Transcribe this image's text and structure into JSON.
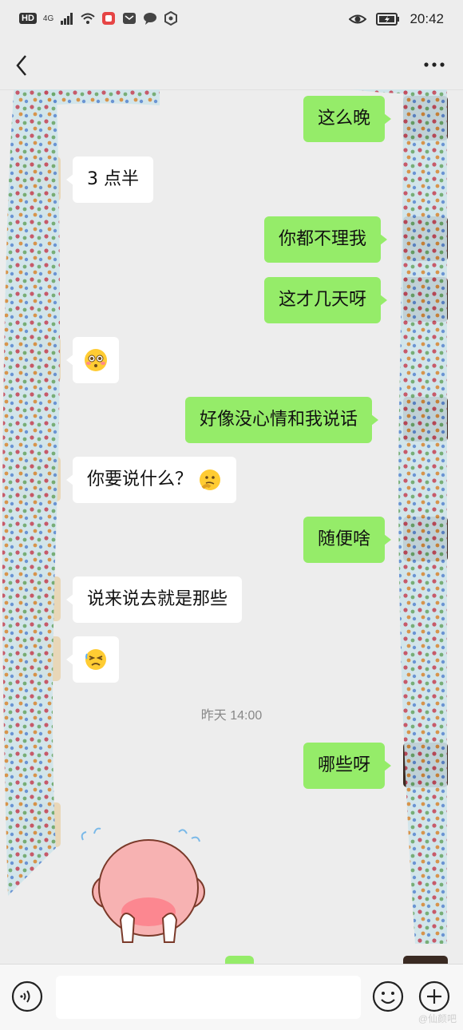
{
  "status_bar": {
    "hd": "HD",
    "network": "4G",
    "time": "20:42",
    "icons": [
      "signal-icon",
      "wifi-icon",
      "app-icon",
      "mail-icon",
      "chat-icon",
      "settings-icon",
      "eye-icon",
      "battery-icon"
    ]
  },
  "header": {
    "back_icon": "chevron-left-icon",
    "more_icon": "more-icon"
  },
  "messages": [
    {
      "side": "right",
      "text": "这么晚"
    },
    {
      "side": "left",
      "text": "3 点半"
    },
    {
      "side": "right",
      "text": "你都不理我"
    },
    {
      "side": "right",
      "text": "这才几天呀"
    },
    {
      "side": "left",
      "emoji": "flushed-face-emoji"
    },
    {
      "side": "right",
      "text": "好像没心情和我说话"
    },
    {
      "side": "left",
      "text": "你要说什么？",
      "emoji": "thinking-face-emoji"
    },
    {
      "side": "right",
      "text": "随便啥"
    },
    {
      "side": "left",
      "text": "说来说去就是那些"
    },
    {
      "side": "left",
      "emoji": "persevering-face-emoji"
    },
    {
      "side": "right",
      "text": "哪些呀"
    },
    {
      "side": "left",
      "sticker": "shy-pink-character-sticker"
    }
  ],
  "timestamp": "昨天 14:00",
  "input_bar": {
    "voice_icon": "voice-icon",
    "emoji_icon": "emoji-icon",
    "plus_icon": "plus-icon"
  },
  "watermark": "@仙颜吧",
  "colors": {
    "bubble_right": "#95ec69",
    "bubble_left": "#ffffff",
    "background": "#ededed"
  }
}
